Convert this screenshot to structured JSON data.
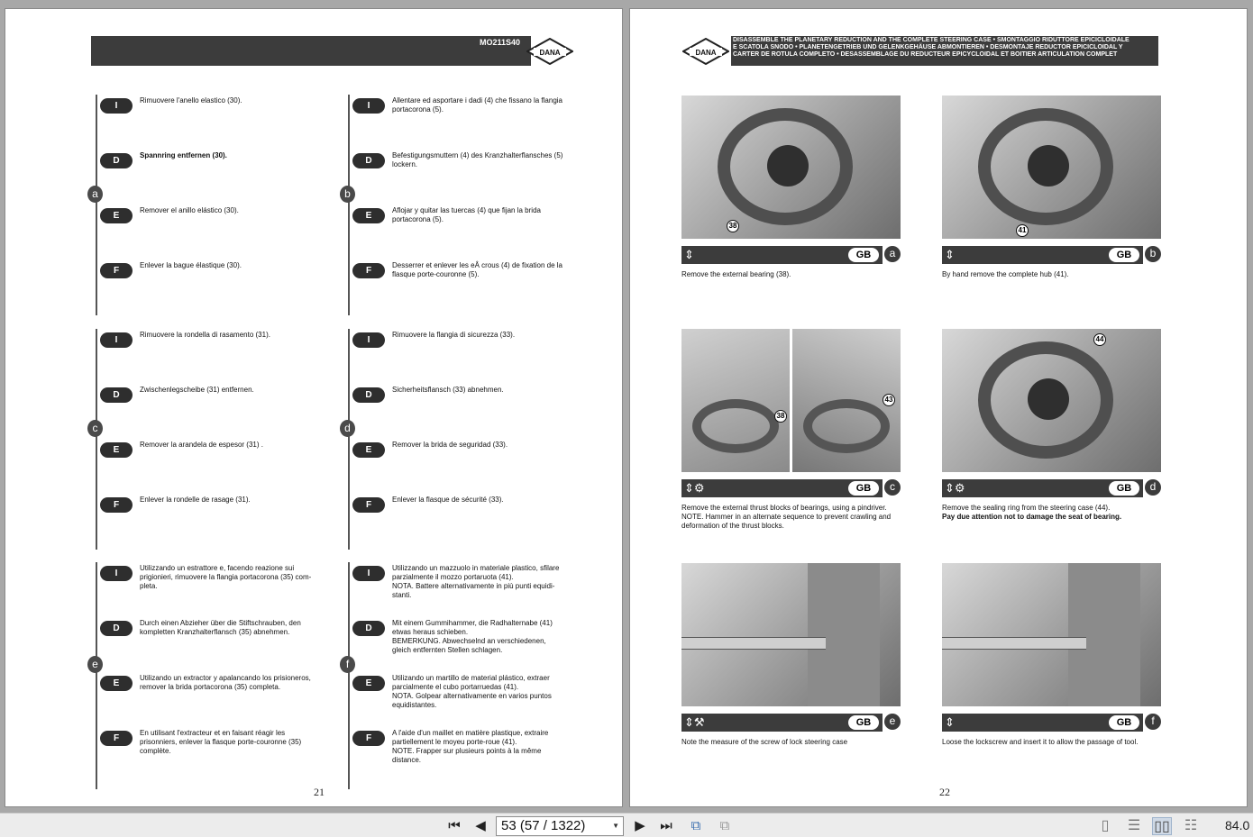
{
  "left_page": {
    "header_code": "MO211S40",
    "logo_text": "DANA",
    "page_number": "21",
    "sections": [
      {
        "letter": "a",
        "rows": [
          {
            "lang": "I",
            "text": "Rimuovere l'anello elastico (30)."
          },
          {
            "lang": "D",
            "text": "Spannring entfernen (30)."
          },
          {
            "lang": "E",
            "text": "Remover el anillo elástico (30)."
          },
          {
            "lang": "F",
            "text": "Enlever la bague élastique (30)."
          }
        ]
      },
      {
        "letter": "b",
        "rows": [
          {
            "lang": "I",
            "text": "Allentare ed asportare i dadi (4) che fissano la flangia\nportacorona (5)."
          },
          {
            "lang": "D",
            "text": "Befestigungsmuttern (4) des Kranzhalterflansches (5)\nlockern."
          },
          {
            "lang": "E",
            "text": "Aflojar y quitar las tuercas (4) que fijan la brida\nportacorona (5)."
          },
          {
            "lang": "F",
            "text": "Desserrer et enlever les eÂ crous (4) de fixation de la\nflasque porte-couronne (5)."
          }
        ]
      },
      {
        "letter": "c",
        "rows": [
          {
            "lang": "I",
            "text": "Rimuovere la rondella di rasamento (31)."
          },
          {
            "lang": "D",
            "text": "Zwischenlegscheibe (31) entfernen."
          },
          {
            "lang": "E",
            "text": "Remover la arandela de espesor (31) ."
          },
          {
            "lang": "F",
            "text": "Enlever la rondelle de rasage (31)."
          }
        ]
      },
      {
        "letter": "d",
        "rows": [
          {
            "lang": "I",
            "text": "Rimuovere la flangia di sicurezza (33)."
          },
          {
            "lang": "D",
            "text": "Sicherheitsflansch (33) abnehmen."
          },
          {
            "lang": "E",
            "text": "Remover la brida de seguridad (33)."
          },
          {
            "lang": "F",
            "text": "Enlever la flasque de sécurité (33)."
          }
        ]
      },
      {
        "letter": "e",
        "rows": [
          {
            "lang": "I",
            "text": "Utilizzando un estrattore e, facendo reazione sui\nprigionieri, rimuovere la flangia portacorona (35) com-\npleta."
          },
          {
            "lang": "D",
            "text": "Durch einen Abzieher über die Stiftschrauben, den\nkompletten Kranzhalterflansch (35) abnehmen."
          },
          {
            "lang": "E",
            "text": "Utilizando un extractor y apalancando los prisioneros,\nremover la brida portacorona (35) completa."
          },
          {
            "lang": "F",
            "text": "En utilisant l'extracteur et en faisant réagir les\nprisonniers, enlever la flasque porte-couronne (35)\ncomplète."
          }
        ]
      },
      {
        "letter": "f",
        "rows": [
          {
            "lang": "I",
            "text": "Utilizzando un mazzuolo in materiale plastico, sfilare\nparzialmente il mozzo portaruota (41).\nNOTA. Battere alternativamente in più punti equidi-\nstanti."
          },
          {
            "lang": "D",
            "text": "Mit einem Gummihammer, die Radhalternabe (41)\netwas heraus schieben.\nBEMERKUNG. Abwechselnd an verschiedenen,\ngleich entfernten Stellen schlagen."
          },
          {
            "lang": "E",
            "text": "Utilizando un martillo de material plástico, extraer\nparcialmente el cubo portarruedas (41).\nNOTA. Golpear alternativamente en varios puntos\nequidistantes."
          },
          {
            "lang": "F",
            "text": "A l'aide d'un maillet en matière plastique, extraire\npartiellement le moyeu porte-roue (41).\nNOTE. Frapper sur plusieurs points à la même\ndistance."
          }
        ]
      }
    ]
  },
  "right_page": {
    "logo_text": "DANA",
    "header_title": "DISASSEMBLE THE PLANETARY REDUCTION AND THE COMPLETE STEERING CASE • SMONTAGGIO RIDUTTORE EPICICLOIDALE\nE SCATOLA SNODO • PLANETENGETRIEB UND GELENKGEHÄUSE ABMONTIEREN • DESMONTAJE REDUCTOR EPICICLOIDAL Y\nCARTER DE ROTULA COMPLETO • DESASSEMBLAGE DU REDUCTEUR EPICYCLOIDAL ET BOITIER ARTICULATION COMPLET",
    "page_number": "22",
    "lang_badge": "GB",
    "cards": [
      {
        "sub": "a",
        "callouts": [
          "38"
        ],
        "icons": "⇕",
        "caption": "Remove the external bearing (38).",
        "caption_bold": ""
      },
      {
        "sub": "b",
        "callouts": [
          "41"
        ],
        "icons": "⇕",
        "caption": "By hand remove the complete hub (41).",
        "caption_bold": ""
      },
      {
        "sub": "c",
        "callouts": [
          "38",
          "43"
        ],
        "icons": "⇕⚙",
        "caption": "Remove the external thrust blocks of bearings, using a pindriver. NOTE. Hammer in an alternate sequence to prevent crawling and deformation of the thrust blocks.",
        "caption_bold": ""
      },
      {
        "sub": "d",
        "callouts": [
          "44"
        ],
        "icons": "⇕⚙",
        "caption": "Remove the sealing ring from the steering case (44).",
        "caption_bold": "Pay due attention not to damage the seat of bearing."
      },
      {
        "sub": "e",
        "callouts": [],
        "icons": "⇕⚒",
        "caption": "Note the measure of the screw of lock steering case",
        "caption_bold": ""
      },
      {
        "sub": "f",
        "callouts": [],
        "icons": "⇕",
        "caption": "Loose the lockscrew and insert it to allow the passage of tool.",
        "caption_bold": ""
      }
    ]
  },
  "viewer": {
    "page_selector": "53 (57 / 1322)",
    "zoom": "84.0",
    "icons": {
      "first": "first-page-icon",
      "prev": "previous-page-icon",
      "next": "next-page-icon",
      "last": "last-page-icon",
      "back": "navigate-back-icon",
      "forward": "navigate-forward-icon"
    }
  }
}
